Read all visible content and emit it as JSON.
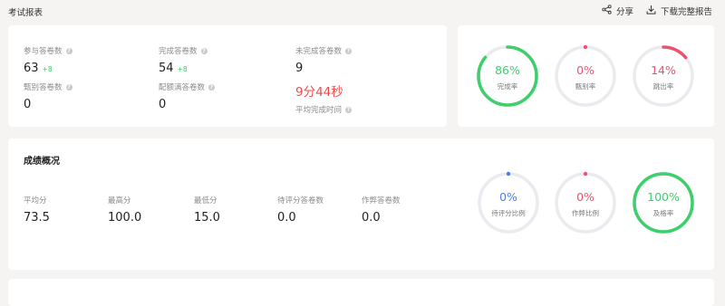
{
  "header": {
    "title": "考试报表",
    "share_label": "分享",
    "download_label": "下载完整报告"
  },
  "stats": {
    "participants": {
      "label": "参与答卷数",
      "value": "63",
      "delta": "+8"
    },
    "completed": {
      "label": "完成答卷数",
      "value": "54",
      "delta": "+8"
    },
    "incomplete": {
      "label": "未完成答卷数",
      "value": "9"
    },
    "jumped": {
      "label": "甄别答卷数",
      "value": "0"
    },
    "quota_full": {
      "label": "配额满答卷数",
      "value": "0"
    },
    "avg_time": {
      "value": "9分44秒",
      "label": "平均完成时间"
    }
  },
  "rings_top": [
    {
      "pct": "86%",
      "label": "完成率",
      "value": 0.86,
      "color": "#3ccf6a",
      "text_color": "#3ccf6a",
      "dot": false
    },
    {
      "pct": "0%",
      "label": "甄别率",
      "value": 0,
      "color": "#f0506e",
      "text_color": "#f0506e",
      "dot": true
    },
    {
      "pct": "14%",
      "label": "跳出率",
      "value": 0.14,
      "color": "#f0506e",
      "text_color": "#f0506e",
      "dot": false
    }
  ],
  "score": {
    "title": "成绩概况",
    "avg": {
      "label": "平均分",
      "value": "73.5"
    },
    "max": {
      "label": "最高分",
      "value": "100.0"
    },
    "min": {
      "label": "最低分",
      "value": "15.0"
    },
    "pending": {
      "label": "待评分答卷数",
      "value": "0.0"
    },
    "cheat": {
      "label": "作弊答卷数",
      "value": "0.0"
    }
  },
  "rings_score": [
    {
      "pct": "0%",
      "label": "待评分比例",
      "value": 0,
      "color": "#4a7cf0",
      "text_color": "#4a7cf0",
      "dot": true
    },
    {
      "pct": "0%",
      "label": "作弊比例",
      "value": 0,
      "color": "#f0506e",
      "text_color": "#f0506e",
      "dot": true
    },
    {
      "pct": "100%",
      "label": "及格率",
      "value": 1.0,
      "color": "#3ccf6a",
      "text_color": "#3ccf6a",
      "dot": false
    }
  ],
  "icons": {
    "share": "share-icon",
    "download": "download-icon",
    "help": "question-icon"
  }
}
